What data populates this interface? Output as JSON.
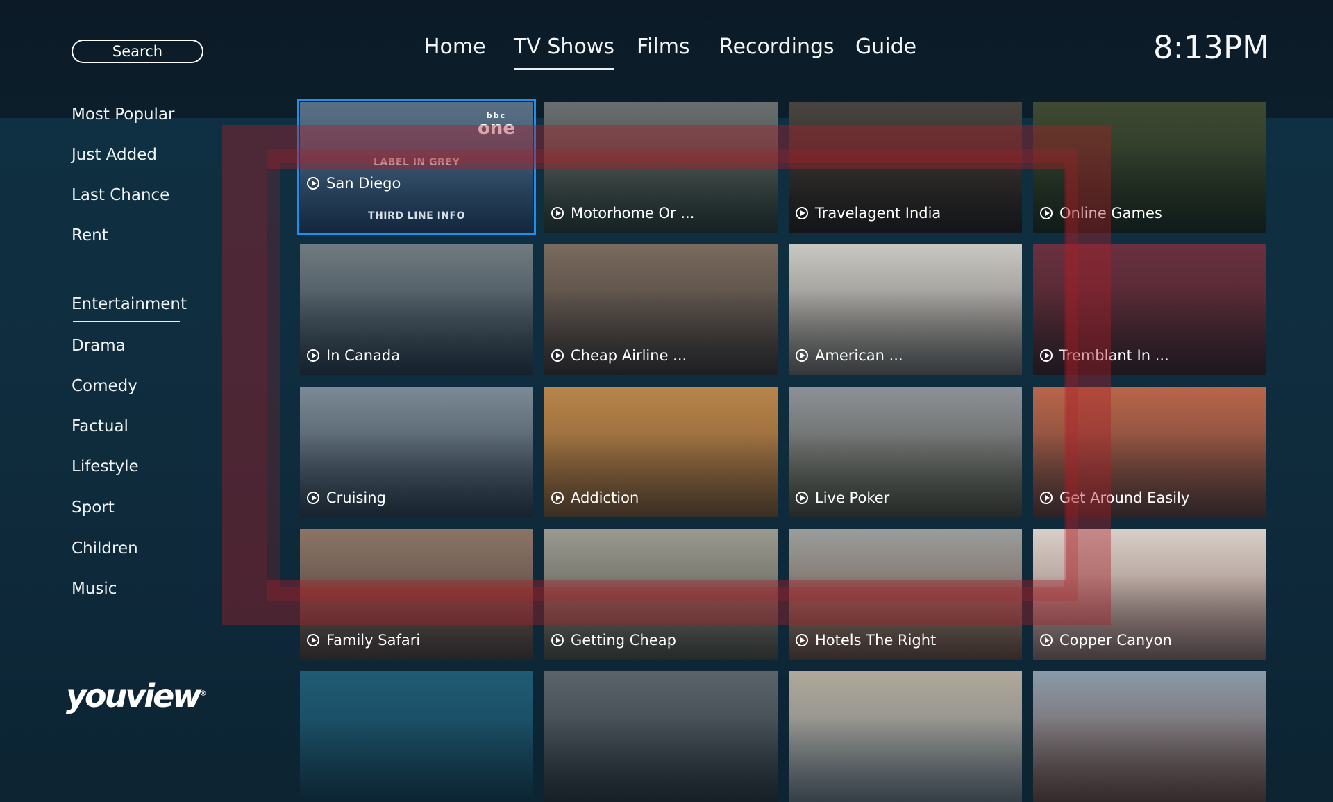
{
  "header": {
    "search_label": "Search",
    "nav": [
      {
        "label": "Home"
      },
      {
        "label": "TV Shows",
        "active": true
      },
      {
        "label": "Films"
      },
      {
        "label": "Recordings"
      },
      {
        "label": "Guide"
      }
    ],
    "clock": "8:13PM"
  },
  "sidebar": {
    "top_items": [
      "Most Popular",
      "Just Added",
      "Last Chance",
      "Rent"
    ],
    "genres": [
      {
        "label": "Entertainment",
        "active": true
      },
      {
        "label": "Drama"
      },
      {
        "label": "Comedy"
      },
      {
        "label": "Factual"
      },
      {
        "label": "Lifestyle"
      },
      {
        "label": "Sport"
      },
      {
        "label": "Children"
      },
      {
        "label": "Music"
      }
    ],
    "logo_text": "youview",
    "logo_mark": "®"
  },
  "focused_tile": {
    "label_top": "LABEL IN GREY",
    "title": "San Diego",
    "label_bottom": "THIRD LINE INFO",
    "channel_logo_small": "bbc",
    "channel_logo": "one"
  },
  "tiles": [
    {
      "title": "San Diego",
      "color_top": "#5b6f82",
      "color_bottom": "#23466a"
    },
    {
      "title": "Motorhome Or ...",
      "color_top": "#6a6e70",
      "color_bottom": "#2a3830"
    },
    {
      "title": "Travelagent India",
      "color_top": "#4a4440",
      "color_bottom": "#231d1a"
    },
    {
      "title": "Online Games",
      "color_top": "#3e4a32",
      "color_bottom": "#1d2a1c"
    },
    {
      "title": "In Canada",
      "color_top": "#6f7b80",
      "color_bottom": "#283642"
    },
    {
      "title": "Cheap Airline ...",
      "color_top": "#7a6a5e",
      "color_bottom": "#3a3430"
    },
    {
      "title": "American  ...",
      "color_top": "#c9c7c2",
      "color_bottom": "#6d6a65"
    },
    {
      "title": "Tremblant In ...",
      "color_top": "#6a3040",
      "color_bottom": "#3b2226"
    },
    {
      "title": "Cruising",
      "color_top": "#7c8a96",
      "color_bottom": "#2c3a46"
    },
    {
      "title": "Addiction",
      "color_top": "#b8854a",
      "color_bottom": "#7a5430"
    },
    {
      "title": "Live Poker",
      "color_top": "#8d9198",
      "color_bottom": "#4a4a3a"
    },
    {
      "title": "Get Around Easily",
      "color_top": "#b8664a",
      "color_bottom": "#5c3a34"
    },
    {
      "title": "Family Safari",
      "color_top": "#8a7466",
      "color_bottom": "#4a3c36"
    },
    {
      "title": "Getting Cheap",
      "color_top": "#9a9a90",
      "color_bottom": "#4c4a40"
    },
    {
      "title": "Hotels The Right",
      "color_top": "#9a9d9c",
      "color_bottom": "#6a4a38"
    },
    {
      "title": "Copper Canyon",
      "color_top": "#d8cfc8",
      "color_bottom": "#8a6a64"
    },
    {
      "title": "",
      "color_top": "#1f5b74",
      "color_bottom": "#163f52"
    },
    {
      "title": "",
      "color_top": "#5a646a",
      "color_bottom": "#2a3338"
    },
    {
      "title": "",
      "color_top": "#b0a89a",
      "color_bottom": "#6f7a80"
    },
    {
      "title": "",
      "color_top": "#8a9aa8",
      "color_bottom": "#6a4a40"
    }
  ]
}
